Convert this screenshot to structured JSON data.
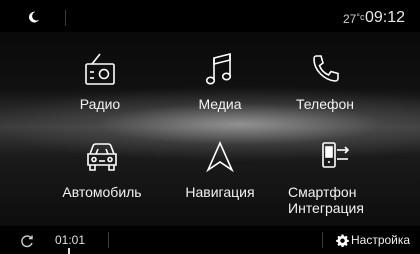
{
  "status_bar": {
    "night_mode_icon": "moon-icon",
    "temperature": "27",
    "temperature_unit": "°c",
    "time": "09:12"
  },
  "menu": {
    "items": [
      {
        "id": "radio",
        "label": "Радио",
        "icon": "radio-icon"
      },
      {
        "id": "media",
        "label": "Медиа",
        "icon": "music-note-icon"
      },
      {
        "id": "phone",
        "label": "Телефон",
        "icon": "phone-icon"
      },
      {
        "id": "car",
        "label": "Автомобиль",
        "icon": "car-icon"
      },
      {
        "id": "navigation",
        "label": "Навигация",
        "icon": "navigation-arrow-icon"
      },
      {
        "id": "smartphone",
        "label_line1": "Смартфон",
        "label_line2": "Интеграция",
        "icon": "smartphone-integration-icon"
      }
    ]
  },
  "bottom_bar": {
    "repeat_icon": "refresh-icon",
    "track_time": "01:01",
    "settings_label": "Настройка",
    "settings_icon": "gear-icon"
  },
  "colors": {
    "background": "#000000",
    "text": "#ffffff",
    "separator": "#3a3a3a"
  }
}
